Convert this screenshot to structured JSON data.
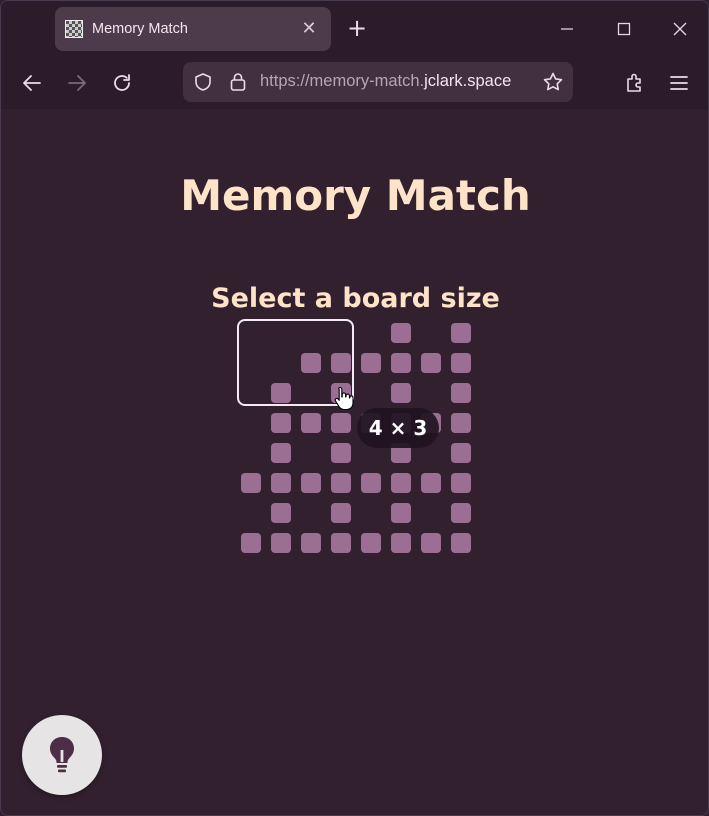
{
  "browser": {
    "tab_title": "Memory Match",
    "url_prefix": "https://memory-match.",
    "url_host": "jclark.space"
  },
  "page": {
    "title": "Memory Match",
    "subtitle": "Select a board size",
    "hover_size_label": "4 × 3"
  },
  "board_picker": {
    "rows": [
      [
        0,
        0,
        0,
        0,
        0,
        1,
        0,
        1
      ],
      [
        0,
        0,
        1,
        1,
        1,
        1,
        1,
        1
      ],
      [
        0,
        1,
        0,
        1,
        0,
        1,
        0,
        1
      ],
      [
        0,
        1,
        1,
        1,
        1,
        1,
        1,
        1
      ],
      [
        0,
        1,
        0,
        1,
        0,
        1,
        0,
        1
      ],
      [
        1,
        1,
        1,
        1,
        1,
        1,
        1,
        1
      ],
      [
        0,
        1,
        0,
        1,
        0,
        1,
        0,
        1
      ],
      [
        1,
        1,
        1,
        1,
        1,
        1,
        1,
        1
      ]
    ],
    "selected_cols": 4,
    "selected_rows": 3
  },
  "colors": {
    "background": "#33202f",
    "accent_text": "#fde3c8",
    "cell": "#9a6f93"
  },
  "icons": {
    "hint_button": "lightbulb-icon"
  }
}
